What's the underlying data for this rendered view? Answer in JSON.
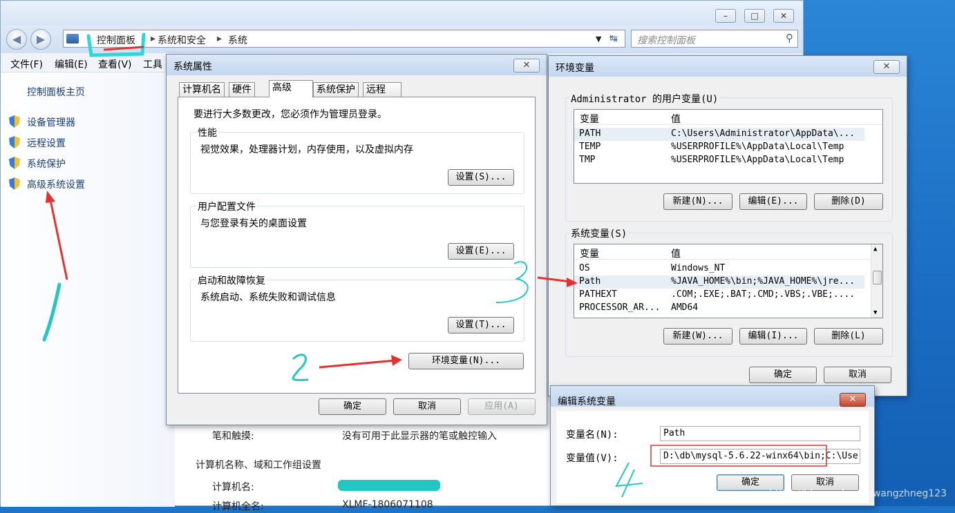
{
  "explorer": {
    "breadcrumbs": [
      "控制面板",
      "系统和安全",
      "系统"
    ],
    "search_placeholder": "搜索控制面板",
    "menu": [
      "文件(F)",
      "编辑(E)",
      "查看(V)",
      "工具"
    ],
    "left": {
      "home": "控制面板主页",
      "items": [
        "设备管理器",
        "远程设置",
        "系统保护",
        "高级系统设置"
      ]
    },
    "lower": {
      "pen_label": "笔和触摸:",
      "pen_value": "没有可用于此显示器的笔或触控输入",
      "section": "计算机名称、域和工作组设置",
      "pc_name_label": "计算机名:",
      "fullname_label": "计算机全名:",
      "fullname_value": "XLMF-1806071108"
    },
    "caption_buttons": [
      "–",
      "□",
      "✕"
    ]
  },
  "sysprops": {
    "title": "系统属性",
    "tabs": [
      "计算机名",
      "硬件",
      "高级",
      "系统保护",
      "远程"
    ],
    "admin_note": "要进行大多数更改，您必须作为管理员登录。",
    "groups": [
      {
        "label": "性能",
        "text": "视觉效果，处理器计划，内存使用，以及虚拟内存",
        "button": "设置(S)..."
      },
      {
        "label": "用户配置文件",
        "text": "与您登录有关的桌面设置",
        "button": "设置(E)..."
      },
      {
        "label": "启动和故障恢复",
        "text": "系统启动、系统失败和调试信息",
        "button": "设置(T)..."
      }
    ],
    "env_button": "环境变量(N)...",
    "ok": "确定",
    "cancel": "取消",
    "apply": "应用(A)"
  },
  "envvars": {
    "title": "环境变量",
    "user_label": "Administrator 的用户变量(U)",
    "col_var": "变量",
    "col_val": "值",
    "user_rows": [
      {
        "name": "PATH",
        "value": "C:\\Users\\Administrator\\AppData\\..."
      },
      {
        "name": "TEMP",
        "value": "%USERPROFILE%\\AppData\\Local\\Temp"
      },
      {
        "name": "TMP",
        "value": "%USERPROFILE%\\AppData\\Local\\Temp"
      }
    ],
    "user_buttons": [
      "新建(N)...",
      "编辑(E)...",
      "删除(D)"
    ],
    "sys_label": "系统变量(S)",
    "sys_rows": [
      {
        "name": "OS",
        "value": "Windows_NT"
      },
      {
        "name": "Path",
        "value": "%JAVA_HOME%\\bin;%JAVA_HOME%\\jre..."
      },
      {
        "name": "PATHEXT",
        "value": ".COM;.EXE;.BAT;.CMD;.VBS;.VBE;...."
      },
      {
        "name": "PROCESSOR_AR...",
        "value": "AMD64"
      }
    ],
    "sys_buttons": [
      "新建(W)...",
      "编辑(I)...",
      "删除(L)"
    ],
    "ok": "确定",
    "cancel": "取消"
  },
  "editvar": {
    "title": "编辑系统变量",
    "name_label": "变量名(N):",
    "name_value": "Path",
    "value_label": "变量值(V):",
    "value_value": "D:\\db\\mysql-5.6.22-winx64\\bin;C:\\Use",
    "ok": "确定",
    "cancel": "取消"
  },
  "watermark": "https://blog.csdn.net/wangzhneg123",
  "annotations": {
    "two": "2",
    "three": "3",
    "four": "4"
  }
}
